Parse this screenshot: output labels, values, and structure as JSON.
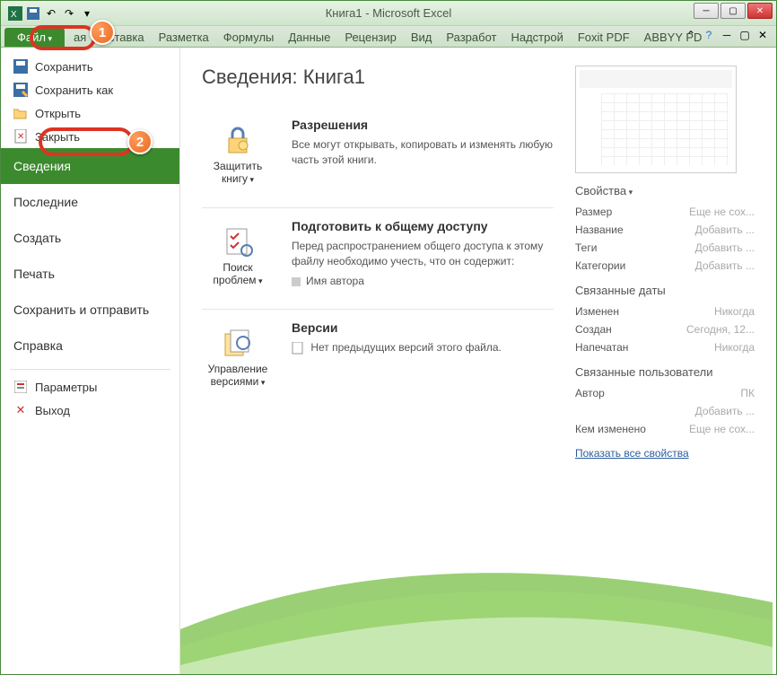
{
  "title": "Книга1  -  Microsoft Excel",
  "tabs": {
    "file": "Файл",
    "list": [
      "ая",
      "Вставка",
      "Разметка",
      "Формулы",
      "Данные",
      "Рецензир",
      "Вид",
      "Разработ",
      "Надстрой",
      "Foxit PDF",
      "ABBYY PD"
    ]
  },
  "sidebar": {
    "top": [
      {
        "icon": "save",
        "label": "Сохранить"
      },
      {
        "icon": "saveas",
        "label": "Сохранить как"
      },
      {
        "icon": "open",
        "label": "Открыть"
      },
      {
        "icon": "close",
        "label": "Закрыть"
      }
    ],
    "mid": [
      {
        "label": "Сведения",
        "active": true
      },
      {
        "label": "Последние"
      },
      {
        "label": "Создать"
      },
      {
        "label": "Печать"
      },
      {
        "label": "Сохранить и отправить"
      },
      {
        "label": "Справка"
      }
    ],
    "bottom": [
      {
        "icon": "options",
        "label": "Параметры"
      },
      {
        "icon": "exit",
        "label": "Выход"
      }
    ]
  },
  "main": {
    "heading": "Сведения: Книга1",
    "permissions": {
      "btn": "Защитить книгу",
      "title": "Разрешения",
      "text": "Все могут открывать, копировать и изменять любую часть этой книги."
    },
    "prepare": {
      "btn": "Поиск проблем",
      "title": "Подготовить к общему доступу",
      "text": "Перед распространением общего доступа к этому файлу необходимо учесть, что он содержит:",
      "bullet": "Имя автора"
    },
    "versions": {
      "btn": "Управление версиями",
      "title": "Версии",
      "text": "Нет предыдущих версий этого файла."
    }
  },
  "props": {
    "head1": "Свойства",
    "rows1": [
      {
        "k": "Размер",
        "v": "Еще не сох..."
      },
      {
        "k": "Название",
        "v": "Добавить ..."
      },
      {
        "k": "Теги",
        "v": "Добавить ..."
      },
      {
        "k": "Категории",
        "v": "Добавить ..."
      }
    ],
    "head2": "Связанные даты",
    "rows2": [
      {
        "k": "Изменен",
        "v": "Никогда"
      },
      {
        "k": "Создан",
        "v": "Сегодня, 12..."
      },
      {
        "k": "Напечатан",
        "v": "Никогда"
      }
    ],
    "head3": "Связанные пользователи",
    "rows3": [
      {
        "k": "Автор",
        "v": "ПК"
      },
      {
        "k": "",
        "v": "Добавить ..."
      },
      {
        "k": "Кем изменено",
        "v": "Еще не сох..."
      }
    ],
    "link": "Показать все свойства"
  }
}
